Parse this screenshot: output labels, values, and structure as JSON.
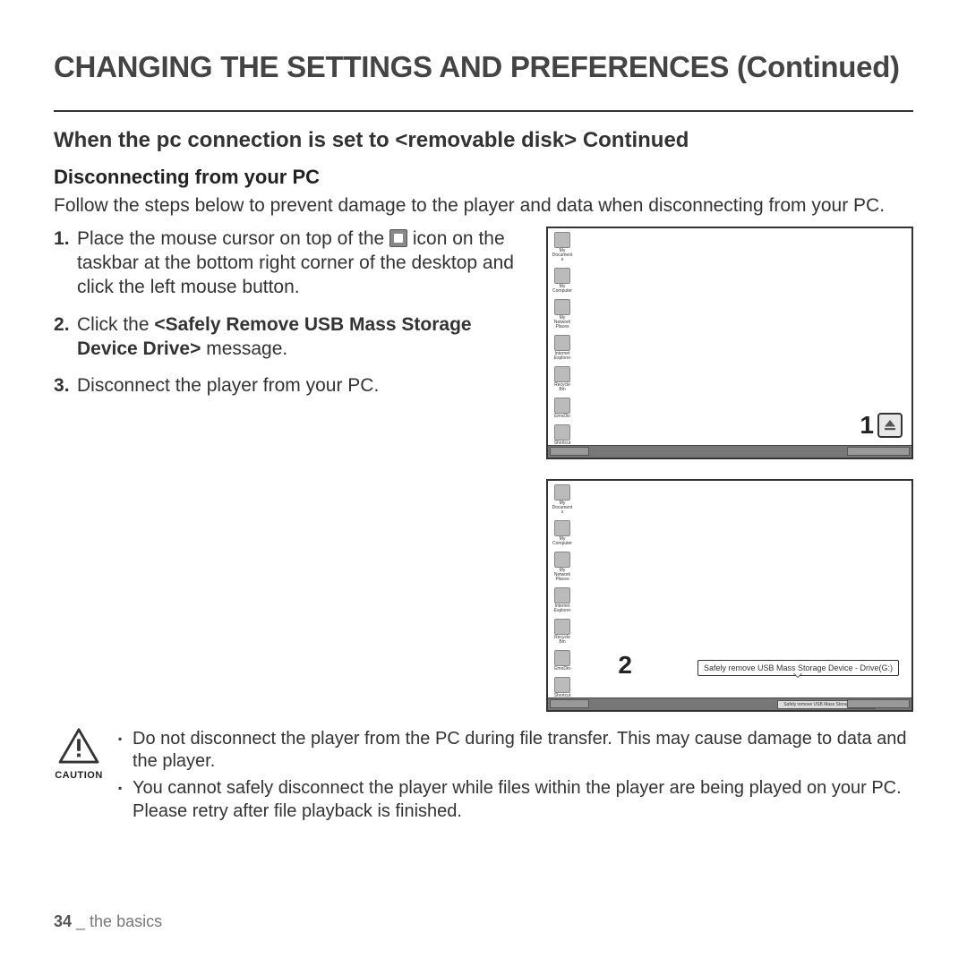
{
  "title": "CHANGING THE SETTINGS AND PREFERENCES (Continued)",
  "subtitle": "When the pc connection is set to <removable disk> Continued",
  "section_head": "Disconnecting from your PC",
  "intro": "Follow the steps below to prevent damage to the player and data when disconnecting from your PC.",
  "steps": {
    "s1_a": "Place the mouse cursor on top of the ",
    "s1_b": " icon on the taskbar at the bottom right corner of the desktop and click the left mouse button.",
    "s2_a": "Click the ",
    "s2_bold": "<Safely Remove USB Mass Storage Device Drive>",
    "s2_b": " message.",
    "s3": "Disconnect the player from your PC."
  },
  "desktop_icons": [
    "My Documents",
    "My Computer",
    "My Network Places",
    "Internet Explorer",
    "Recycle Bin",
    "EmoDio",
    "Shortcut"
  ],
  "callouts": {
    "one": "1",
    "two": "2"
  },
  "tooltip": "Safely remove USB Mass Storage Device - Drive(G:)",
  "caution": {
    "label": "CAUTION",
    "items": [
      "Do not disconnect the player from the PC during file transfer. This may cause damage to data and the player.",
      "You cannot safely disconnect the player while files within the player are being played on your PC. Please retry after file playback is finished."
    ]
  },
  "footer": {
    "page": "34",
    "sep": " _ ",
    "section": "the basics"
  }
}
